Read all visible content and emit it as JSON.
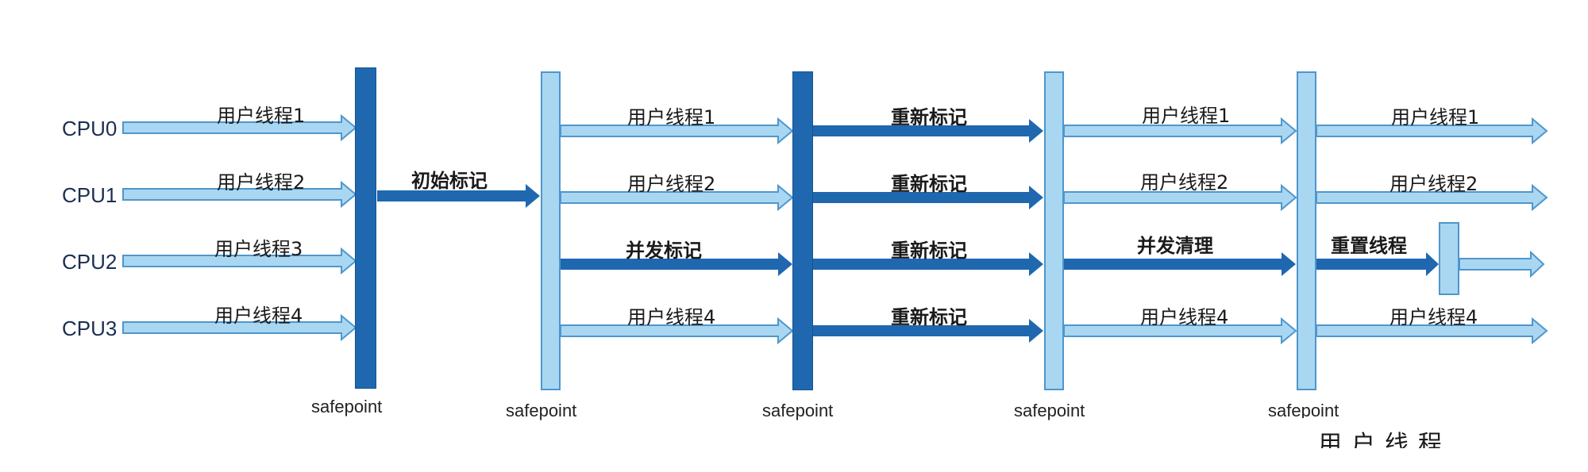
{
  "cpus": [
    "CPU0",
    "CPU1",
    "CPU2",
    "CPU3"
  ],
  "phase1": {
    "thread_labels": [
      "用户线程1",
      "用户线程2",
      "用户线程3",
      "用户线程4"
    ]
  },
  "phase2": {
    "label": "初始标记"
  },
  "phase3": {
    "labels": [
      "用户线程1",
      "用户线程2",
      "并发标记",
      "用户线程4"
    ]
  },
  "phase4": {
    "labels": [
      "重新标记",
      "重新标记",
      "重新标记",
      "重新标记"
    ]
  },
  "phase5": {
    "labels": [
      "用户线程1",
      "用户线程2",
      "并发清理",
      "用户线程4"
    ]
  },
  "phase6": {
    "labels": [
      "用户线程1",
      "用户线程2",
      "重置线程",
      "用户线程4"
    ]
  },
  "safepoint_label": "safepoint",
  "bottom_fragment": "用户线程",
  "colors": {
    "dark_blue": "#1f68b0",
    "light_blue": "#a9d7f2",
    "light_blue_border": "#4f96cc",
    "dark_text": "#1a1a1a"
  }
}
